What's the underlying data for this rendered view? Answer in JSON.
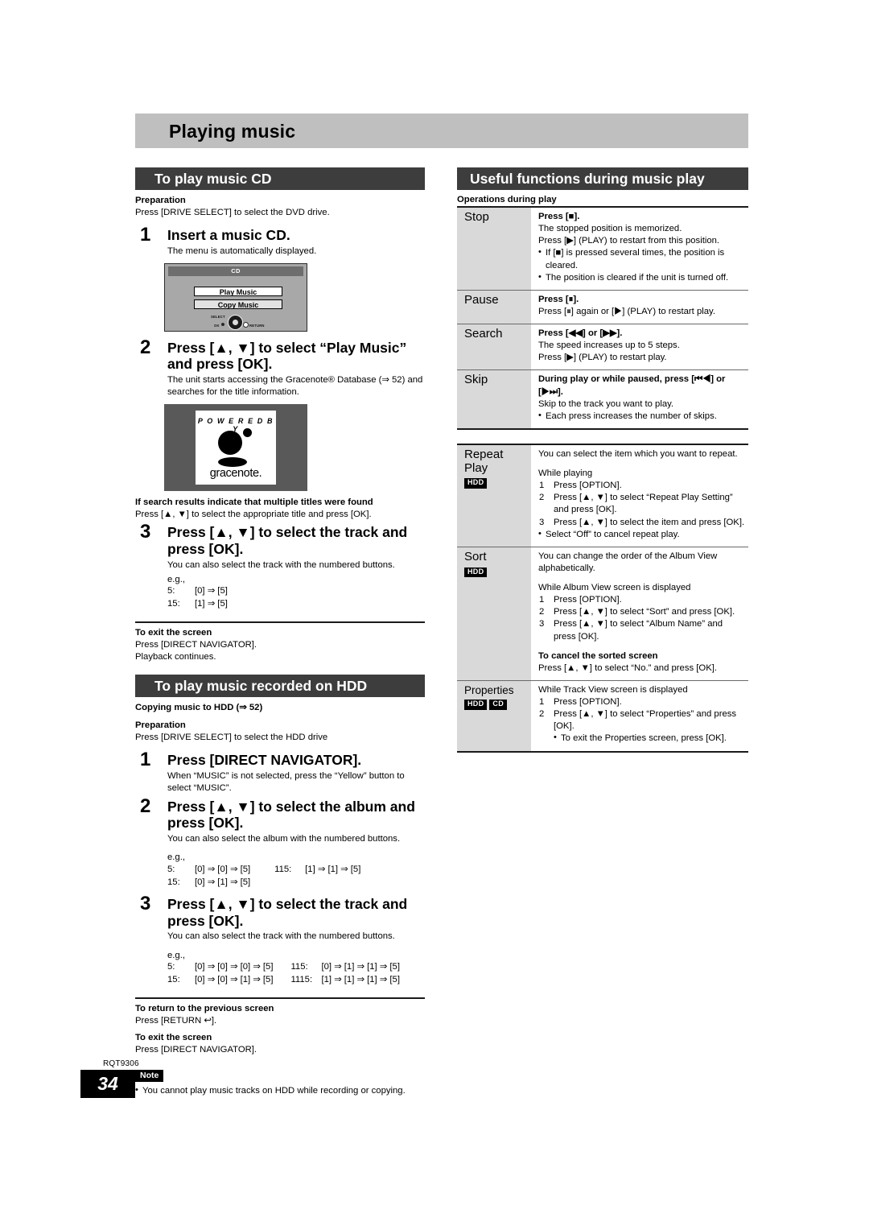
{
  "chapter": {
    "title": "Playing music"
  },
  "left": {
    "section1": {
      "header": "To play music CD",
      "preparation_label": "Preparation",
      "preparation_text": "Press [DRIVE SELECT] to select the DVD drive.",
      "step1": {
        "num": "1",
        "head": "Insert a music CD.",
        "desc": "The menu is automatically displayed."
      },
      "cd_screen": {
        "title": "CD",
        "item_selected": "Play Music",
        "item_unselected": "Copy Music",
        "joy_select": "SELECT",
        "joy_ok": "OK",
        "joy_return": "RETURN"
      },
      "step2": {
        "num": "2",
        "head": "Press [▲, ▼] to select “Play Music” and press [OK].",
        "desc": "The unit starts accessing the Gracenote® Database (⇒ 52) and searches for the title information."
      },
      "gracenote": {
        "powered_by": "P O W E R E D   B Y",
        "wordmark": "gracenote."
      },
      "multi_title_head": "If search results indicate that multiple titles were found",
      "multi_title_text": "Press [▲, ▼] to select the appropriate title and press [OK].",
      "step3": {
        "num": "3",
        "head": "Press [▲, ▼] to select the track and press [OK].",
        "desc": "You can also select the track with the numbered buttons.",
        "eg_label": "e.g.,",
        "eg_rows": [
          {
            "label": "5:",
            "keys": "[0] ⇒ [5]"
          },
          {
            "label": "15:",
            "keys": "[1] ⇒ [5]"
          }
        ]
      },
      "exit_head": "To exit the screen",
      "exit_line1": "Press [DIRECT NAVIGATOR].",
      "exit_line2": "Playback continues."
    },
    "section2": {
      "header": "To play music recorded on HDD",
      "copying_line": "Copying music to HDD (⇒ 52)",
      "preparation_label": "Preparation",
      "preparation_text": "Press [DRIVE SELECT] to select the HDD drive",
      "step1": {
        "num": "1",
        "head": "Press [DIRECT NAVIGATOR].",
        "desc": "When “MUSIC” is not selected, press the “Yellow” button to select “MUSIC”."
      },
      "step2": {
        "num": "2",
        "head": "Press [▲, ▼] to select the album and press [OK].",
        "desc": "You can also select the album with the numbered buttons.",
        "eg_label": "e.g.,",
        "eg_rows": [
          {
            "label": "5:",
            "keys": "[0] ⇒ [0] ⇒ [5]",
            "label2": "115:",
            "keys2": "[1] ⇒ [1] ⇒ [5]"
          },
          {
            "label": "15:",
            "keys": "[0] ⇒ [1] ⇒ [5]",
            "label2": "",
            "keys2": ""
          }
        ]
      },
      "step3": {
        "num": "3",
        "head": "Press [▲, ▼] to select the track and press [OK].",
        "desc": "You can also select the track with the numbered buttons.",
        "eg_label": "e.g.,",
        "eg_rows": [
          {
            "label": "5:",
            "keys": "[0] ⇒ [0] ⇒ [0] ⇒ [5]",
            "label2": "115:",
            "keys2": "[0] ⇒ [1] ⇒ [1] ⇒ [5]"
          },
          {
            "label": "15:",
            "keys": "[0] ⇒ [0] ⇒ [1] ⇒ [5]",
            "label2": "1115:",
            "keys2": "[1] ⇒ [1] ⇒ [1] ⇒ [5]"
          }
        ]
      },
      "return_head": "To return to the previous screen",
      "return_text": "Press [RETURN ↩].",
      "exit_head": "To exit the screen",
      "exit_text": "Press [DIRECT NAVIGATOR].",
      "note_badge": "Note",
      "note_text": "You cannot play music tracks on HDD while recording or copying."
    }
  },
  "right": {
    "header": "Useful functions during music play",
    "operations_label": "Operations during play",
    "table1": [
      {
        "key": "Stop",
        "bold": "Press [■].",
        "lines": [
          "The stopped position is memorized.",
          "Press [▶] (PLAY) to restart from this position."
        ],
        "bullets": [
          "If [■] is pressed several times, the position is cleared.",
          "The position is cleared if the unit is turned off."
        ]
      },
      {
        "key": "Pause",
        "bold": "Press [⏸].",
        "lines": [
          "Press [⏸] again or [▶] (PLAY) to restart play."
        ],
        "bullets": []
      },
      {
        "key": "Search",
        "bold": "Press [◀◀] or [▶▶].",
        "lines": [
          "The speed increases up to 5 steps.",
          "Press [▶] (PLAY) to restart play."
        ],
        "bullets": []
      },
      {
        "key": "Skip",
        "bold": "During play or while paused, press [⏮◀] or [▶⏭].",
        "lines": [
          "Skip to the track you want to play."
        ],
        "bullets": [
          "Each press increases the number of skips."
        ]
      }
    ],
    "table2": [
      {
        "key_line1": "Repeat",
        "key_line2": "Play",
        "tags": [
          "HDD"
        ],
        "intro": "You can select the item which you want to repeat.",
        "context": "While playing",
        "steps": [
          "Press [OPTION].",
          "Press [▲, ▼] to select “Repeat Play Setting” and press [OK].",
          "Press [▲, ▼] to select the item and press [OK]."
        ],
        "bullets": [
          "Select “Off” to cancel repeat play."
        ],
        "sub_head": "",
        "sub_text": ""
      },
      {
        "key_line1": "Sort",
        "key_line2": "",
        "tags": [
          "HDD"
        ],
        "intro": "You can change the order of the Album View alphabetically.",
        "context": "While Album View screen is displayed",
        "steps": [
          "Press [OPTION].",
          "Press [▲, ▼] to select “Sort” and press [OK].",
          "Press [▲, ▼] to select “Album Name” and press [OK]."
        ],
        "bullets": [],
        "sub_head": "To cancel the sorted screen",
        "sub_text": "Press [▲, ▼] to select “No.” and press [OK]."
      },
      {
        "key_line1": "Properties",
        "key_line2": "",
        "tags": [
          "HDD",
          "CD"
        ],
        "intro": "",
        "context": "While Track View screen is displayed",
        "steps": [
          "Press [OPTION].",
          "Press [▲, ▼] to select “Properties” and press [OK]."
        ],
        "bullets": [],
        "indented_bullets": [
          "To exit the Properties screen, press [OK]."
        ],
        "sub_head": "",
        "sub_text": ""
      }
    ]
  },
  "footer": {
    "rqt": "RQT9306",
    "page": "34"
  }
}
